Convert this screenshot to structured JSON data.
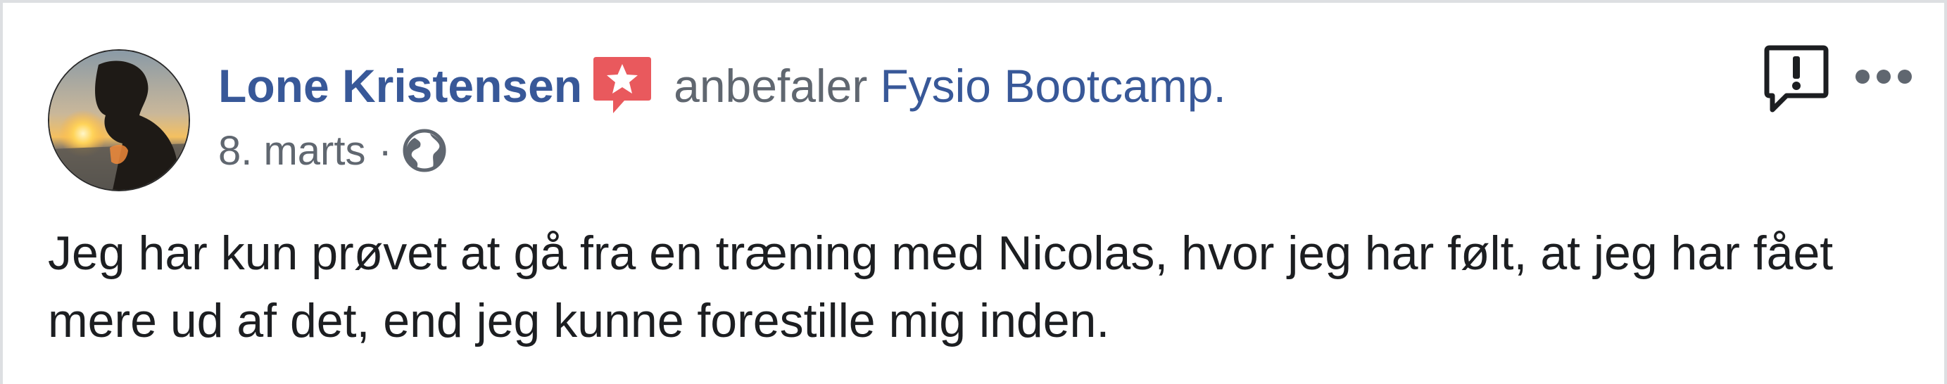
{
  "post": {
    "author": "Lone Kristensen",
    "verb": "anbefaler",
    "page_name": "Fysio Bootcamp",
    "page_suffix": ".",
    "date": "8. marts",
    "separator": "·",
    "privacy_icon": "globe-icon",
    "badge_icon": "recommendation-star-icon",
    "body": "Jeg har kun prøvet at gå fra en træning med Nicolas, hvor jeg har følt, at jeg har fået mere ud af det, end jeg kunne forestille mig inden."
  },
  "actions": {
    "report_icon": "report-exclamation-icon",
    "more_icon": "more-options-icon"
  },
  "colors": {
    "link": "#385898",
    "secondary_text": "#606770",
    "body_text": "#1c1e21",
    "badge": "#e9595d",
    "border": "#dddfe2"
  }
}
